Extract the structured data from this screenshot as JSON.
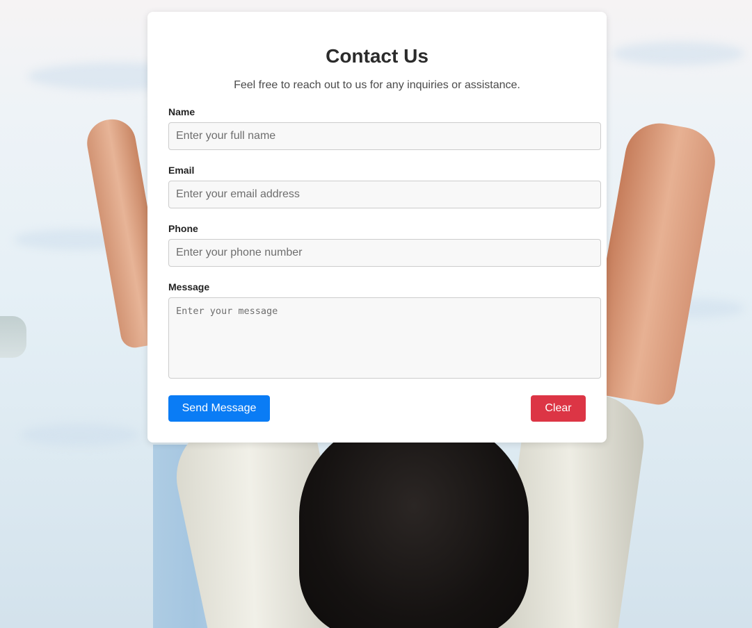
{
  "form": {
    "title": "Contact Us",
    "subtitle": "Feel free to reach out to us for any inquiries or assistance.",
    "fields": {
      "name": {
        "label": "Name",
        "value": "",
        "placeholder": "Enter your full name"
      },
      "email": {
        "label": "Email",
        "value": "",
        "placeholder": "Enter your email address"
      },
      "phone": {
        "label": "Phone",
        "value": "",
        "placeholder": "Enter your phone number"
      },
      "message": {
        "label": "Message",
        "value": "",
        "placeholder": "Enter your message"
      }
    },
    "buttons": {
      "send_label": "Send Message",
      "clear_label": "Clear"
    }
  },
  "colors": {
    "primary": "#0a7cf5",
    "danger": "#dc3545",
    "card_background": "#ffffff",
    "input_background": "#f8f8f8",
    "input_border": "#cccccc",
    "heading_text": "#2b2b2b"
  }
}
